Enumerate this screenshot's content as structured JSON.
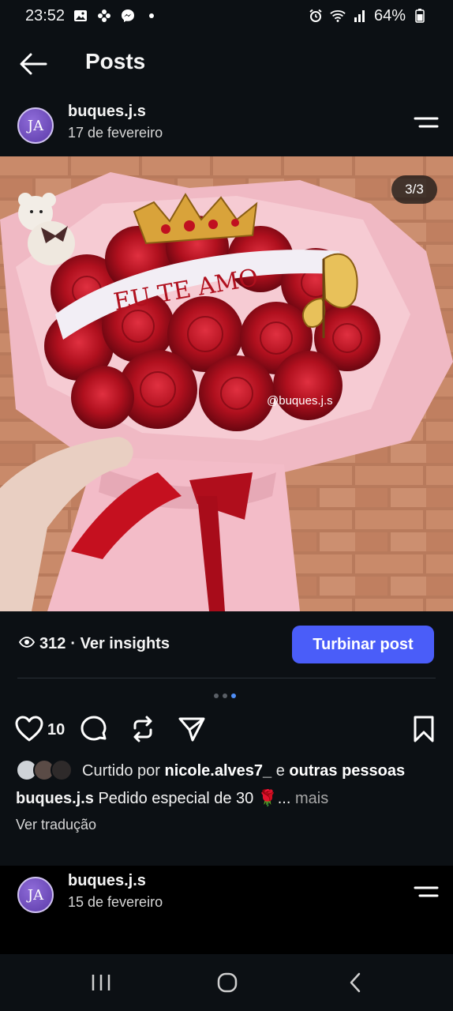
{
  "status_bar": {
    "time": "23:52",
    "battery": "64%",
    "left_icons": [
      "gallery-icon",
      "pinwheel-icon",
      "messenger-icon",
      "dot-icon"
    ],
    "right_icons": [
      "alarm-icon",
      "wifi-icon",
      "signal-icon",
      "battery-icon"
    ]
  },
  "header": {
    "title": "Posts",
    "back_icon": "back-arrow-icon"
  },
  "post": {
    "avatar_initials": "JA",
    "username": "buques.j.s",
    "date": "17 de fevereiro",
    "image_counter": "3/3",
    "image_watermark": "@buques.j.s",
    "ribbon_text": "EU TE AMO",
    "views": "312",
    "insights_label": "· Ver insights",
    "boost_label": "Turbinar post",
    "like_count": "10",
    "liked_prefix": "Curtido por",
    "liked_user": "nicole.alves7_",
    "liked_and": "e",
    "liked_others": "outras pessoas",
    "caption_user": "buques.j.s",
    "caption_text": "Pedido especial de 30 🌹...",
    "caption_more": "mais",
    "translate_label": "Ver tradução",
    "carousel_total": 3,
    "carousel_active": 3
  },
  "next_post": {
    "avatar_initials": "JA",
    "username": "buques.j.s",
    "date": "15 de fevereiro"
  },
  "colors": {
    "background": "#0c1014",
    "boost_button": "#4a5df9",
    "active_dot": "#4f8ef7"
  }
}
